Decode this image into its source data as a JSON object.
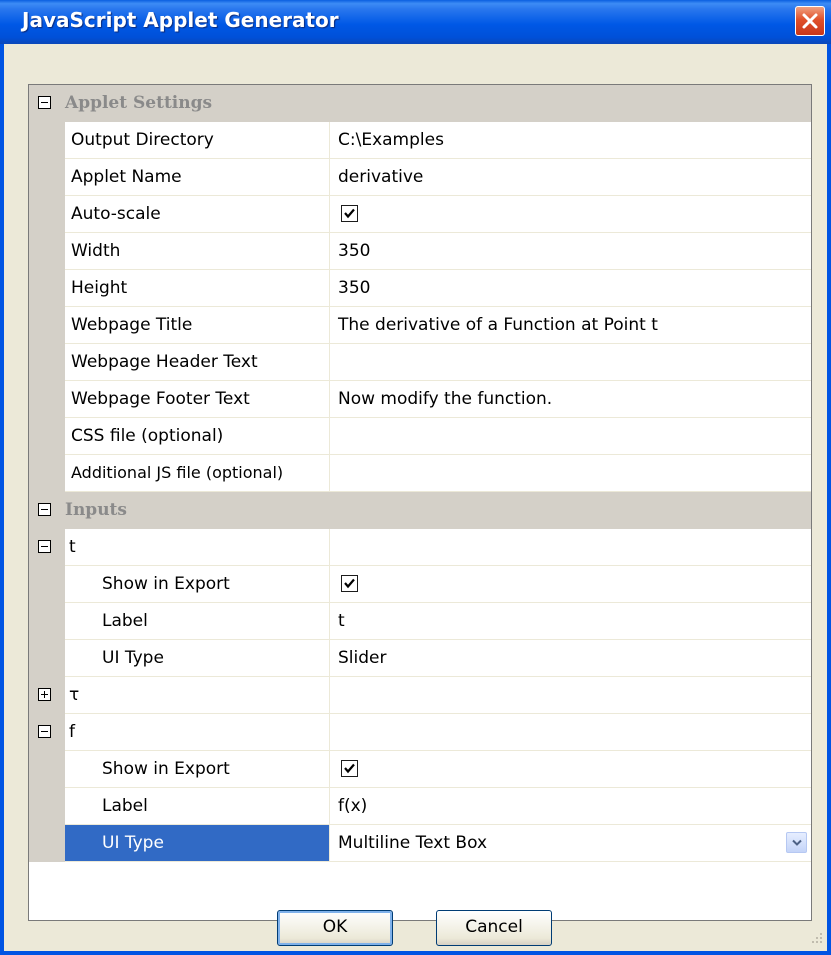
{
  "window": {
    "title": "JavaScript Applet Generator"
  },
  "grid": {
    "applet_settings": {
      "title": "Applet Settings",
      "rows": [
        {
          "name": "Output Directory",
          "value": "C:\\Examples"
        },
        {
          "name": "Applet Name",
          "value": "derivative"
        },
        {
          "name": "Auto-scale",
          "checked": true
        },
        {
          "name": "Width",
          "value": "350"
        },
        {
          "name": "Height",
          "value": "350"
        },
        {
          "name": "Webpage Title",
          "value": "The derivative of a Function at Point t"
        },
        {
          "name": "Webpage Header Text",
          "value": ""
        },
        {
          "name": "Webpage Footer Text",
          "value": "Now modify the function."
        },
        {
          "name": "CSS file (optional)",
          "value": ""
        },
        {
          "name": "Additional JS file (optional)",
          "value": ""
        }
      ]
    },
    "inputs": {
      "title": "Inputs",
      "t": {
        "name": "t",
        "show_in_export": {
          "name": "Show in Export",
          "checked": true
        },
        "label": {
          "name": "Label",
          "value": "t"
        },
        "ui_type": {
          "name": "UI Type",
          "value": "Slider"
        }
      },
      "tau": {
        "name": "τ"
      },
      "f": {
        "name": "f",
        "show_in_export": {
          "name": "Show in Export",
          "checked": true
        },
        "label": {
          "name": "Label",
          "value": "f(x)"
        },
        "ui_type": {
          "name": "UI Type",
          "value": "Multiline Text Box"
        }
      }
    }
  },
  "buttons": {
    "ok": "OK",
    "cancel": "Cancel"
  }
}
